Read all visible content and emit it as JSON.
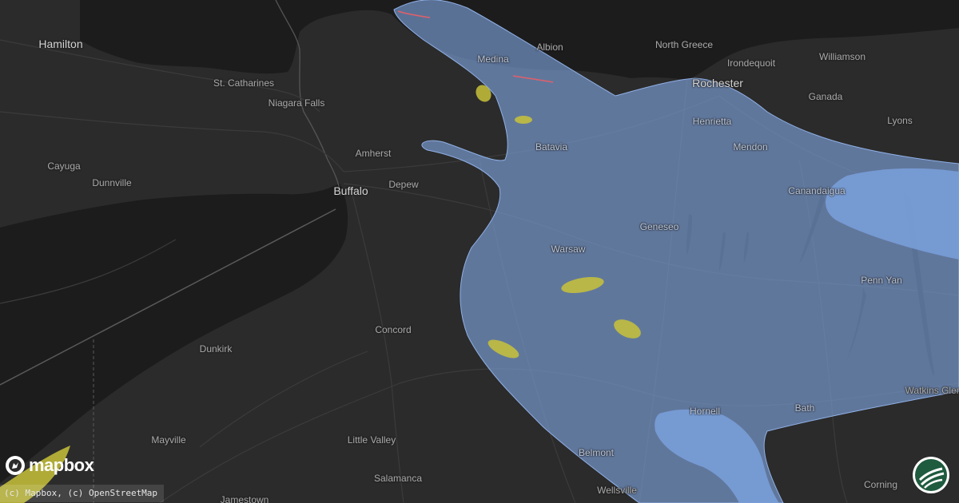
{
  "map": {
    "places": [
      {
        "id": "hamilton",
        "name": "Hamilton",
        "major": true
      },
      {
        "id": "st-catharines",
        "name": "St. Catharines",
        "major": false
      },
      {
        "id": "niagara-falls",
        "name": "Niagara Falls",
        "major": false
      },
      {
        "id": "cayuga",
        "name": "Cayuga",
        "major": false
      },
      {
        "id": "dunnville",
        "name": "Dunnville",
        "major": false
      },
      {
        "id": "buffalo",
        "name": "Buffalo",
        "major": true
      },
      {
        "id": "amherst",
        "name": "Amherst",
        "major": false
      },
      {
        "id": "depew",
        "name": "Depew",
        "major": false
      },
      {
        "id": "medina",
        "name": "Medina",
        "major": false
      },
      {
        "id": "albion",
        "name": "Albion",
        "major": false
      },
      {
        "id": "batavia",
        "name": "Batavia",
        "major": false
      },
      {
        "id": "north-greece",
        "name": "North Greece",
        "major": false
      },
      {
        "id": "irondequoit",
        "name": "Irondequoit",
        "major": false
      },
      {
        "id": "williamson",
        "name": "Williamson",
        "major": false
      },
      {
        "id": "rochester",
        "name": "Rochester",
        "major": true
      },
      {
        "id": "henrietta",
        "name": "Henrietta",
        "major": false
      },
      {
        "id": "ganada",
        "name": "Ganada",
        "major": false
      },
      {
        "id": "lyons",
        "name": "Lyons",
        "major": false
      },
      {
        "id": "mendon",
        "name": "Mendon",
        "major": false
      },
      {
        "id": "canandaigua",
        "name": "Canandaigua",
        "major": false
      },
      {
        "id": "geneseo",
        "name": "Geneseo",
        "major": false
      },
      {
        "id": "warsaw",
        "name": "Warsaw",
        "major": false
      },
      {
        "id": "penn-yan",
        "name": "Penn Yan",
        "major": false
      },
      {
        "id": "concord",
        "name": "Concord",
        "major": false
      },
      {
        "id": "dunkirk",
        "name": "Dunkirk",
        "major": false
      },
      {
        "id": "mayville",
        "name": "Mayville",
        "major": false
      },
      {
        "id": "little-valley",
        "name": "Little Valley",
        "major": false
      },
      {
        "id": "salamanca",
        "name": "Salamanca",
        "major": false
      },
      {
        "id": "jamestown",
        "name": "Jamestown",
        "major": false
      },
      {
        "id": "belmont",
        "name": "Belmont",
        "major": false
      },
      {
        "id": "wellsville",
        "name": "Wellsville",
        "major": false
      },
      {
        "id": "hornell",
        "name": "Hornell",
        "major": false
      },
      {
        "id": "bath",
        "name": "Bath",
        "major": false
      },
      {
        "id": "watkins-glen",
        "name": "Watkins Glen",
        "major": false
      },
      {
        "id": "corning",
        "name": "Corning",
        "major": false
      }
    ],
    "colors": {
      "land": "#2b2b2b",
      "water": "#1c1c1c",
      "hail_zone": "#7d9fd8",
      "yellow_cell": "#c8c23a",
      "red_line": "#e0606a"
    }
  },
  "logo": {
    "text": "mapbox"
  },
  "attribution": {
    "text": "(c) Mapbox, (c) OpenStreetMap"
  },
  "badge": {
    "icon": "brand-badge-icon"
  }
}
